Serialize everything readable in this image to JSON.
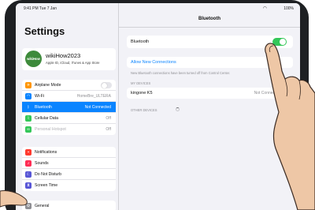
{
  "status": {
    "time": "9:41 PM  Tue 7 Jan",
    "wifi": "wifi-icon",
    "battery": "100%"
  },
  "sidebar": {
    "title": "Settings",
    "profile": {
      "avatar": "wikiHow",
      "name": "wikiHow2023",
      "subtitle": "Apple ID, iCloud, iTunes & App Store"
    },
    "group1": [
      {
        "label": "Airplane Mode",
        "icon": "airplane-icon",
        "color": "#ff9500",
        "toggle": true
      },
      {
        "label": "Wi-Fi",
        "value": "HomeBre_ULTERA",
        "icon": "wifi-icon",
        "color": "#0a84ff"
      },
      {
        "label": "Bluetooth",
        "value": "Not Connected",
        "icon": "bluetooth-icon",
        "color": "#0a84ff",
        "selected": true
      },
      {
        "label": "Cellular Data",
        "value": "Off",
        "icon": "antenna-icon",
        "color": "#34c759"
      },
      {
        "label": "Personal Hotspot",
        "value": "Off",
        "icon": "hotspot-icon",
        "color": "#34c759",
        "dim": true
      }
    ],
    "group2": [
      {
        "label": "Notifications",
        "icon": "notifications-icon",
        "color": "#ff3b30"
      },
      {
        "label": "Sounds",
        "icon": "sounds-icon",
        "color": "#ff2d55"
      },
      {
        "label": "Do Not Disturb",
        "icon": "moon-icon",
        "color": "#5856d6"
      },
      {
        "label": "Screen Time",
        "icon": "hourglass-icon",
        "color": "#5856d6"
      }
    ],
    "group3": [
      {
        "label": "General",
        "icon": "gear-icon",
        "color": "#8e8e93"
      }
    ]
  },
  "detail": {
    "title": "Bluetooth",
    "bluetooth_label": "Bluetooth",
    "bluetooth_on": true,
    "allow_label": "Allow New Connections",
    "note": "New Bluetooth connections have been turned off from Control Center.",
    "my_devices_header": "MY DEVICES",
    "device": {
      "name": "kingone K5",
      "status": "Not Connected"
    },
    "other_devices_header": "OTHER DEVICES"
  },
  "colors": {
    "accent": "#0a84ff",
    "toggle_on": "#34c759",
    "bezel": "#1e2023",
    "skin": "#eec7a6"
  }
}
